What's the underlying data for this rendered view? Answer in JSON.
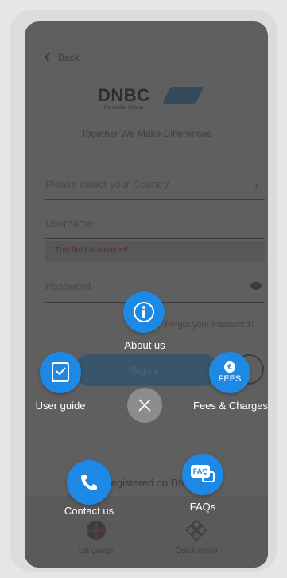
{
  "header": {
    "back_label": "Back"
  },
  "brand": {
    "logo_text": "DNBC",
    "logo_sub": "Financial Group",
    "tagline": "Together We Make Differences"
  },
  "form": {
    "country_placeholder": "Please select your Country",
    "username_placeholder": "Username",
    "error_required": "This field is required!",
    "password_placeholder": "Password",
    "forgot_password": "Forgot your Password?",
    "signin_label": "Sign in",
    "registered_text": "Haven't registered on DNBC yet?"
  },
  "bottom_nav": {
    "language_label": "Language",
    "quick_menu_label": "Quick menu"
  },
  "quick_menu": {
    "about_label": "About us",
    "user_guide_label": "User guide",
    "fees_label": "Fees & Charges",
    "fees_icon_text": "FEES",
    "contact_label": "Contact us",
    "faqs_label": "FAQs",
    "faq_icon_text": "FAQ"
  },
  "colors": {
    "accent": "#1e88e5",
    "overlay": "#5f5f5f"
  }
}
